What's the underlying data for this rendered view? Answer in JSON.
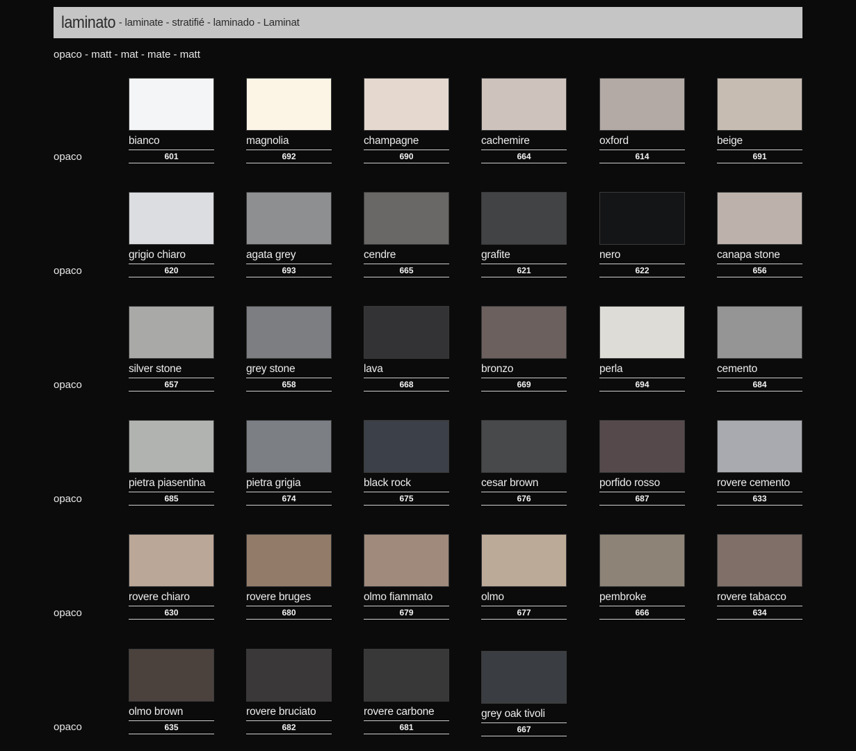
{
  "header": {
    "title": "laminato",
    "subtitle": "- laminate - stratifié - laminado - Laminat"
  },
  "finish_line": "opaco - matt - mat - mate - matt",
  "rows": [
    {
      "label": "opaco",
      "swatches": [
        {
          "name": "bianco",
          "code": "601",
          "color": "#f4f5f7"
        },
        {
          "name": "magnolia",
          "code": "692",
          "color": "#fcf5e6"
        },
        {
          "name": "champagne",
          "code": "690",
          "color": "#e4d8cf"
        },
        {
          "name": "cachemire",
          "code": "664",
          "color": "#cdc3bc"
        },
        {
          "name": "oxford",
          "code": "614",
          "color": "#b3aaa5"
        },
        {
          "name": "beige",
          "code": "691",
          "color": "#c6bcb2"
        }
      ]
    },
    {
      "label": "opaco",
      "swatches": [
        {
          "name": "grigio chiaro",
          "code": "620",
          "color": "#dcdde0"
        },
        {
          "name": "agata grey",
          "code": "693",
          "color": "#8e8f91"
        },
        {
          "name": "cendre",
          "code": "665",
          "color": "#6a6866"
        },
        {
          "name": "grafite",
          "code": "621",
          "color": "#424345"
        },
        {
          "name": "nero",
          "code": "622",
          "color": "#141516"
        },
        {
          "name": "canapa stone",
          "code": "656",
          "color": "#bcb1ab"
        }
      ]
    },
    {
      "label": "opaco",
      "swatches": [
        {
          "name": "silver stone",
          "code": "657",
          "color": "#a9aaa8"
        },
        {
          "name": "grey stone",
          "code": "658",
          "color": "#7c7e82"
        },
        {
          "name": "lava",
          "code": "668",
          "color": "#333234"
        },
        {
          "name": "bronzo",
          "code": "669",
          "color": "#6b605d"
        },
        {
          "name": "perla",
          "code": "694",
          "color": "#dddcd7"
        },
        {
          "name": "cemento",
          "code": "684",
          "color": "#959595"
        }
      ]
    },
    {
      "label": "opaco",
      "swatches": [
        {
          "name": "pietra piasentina",
          "code": "685",
          "color": "#b1b3b1"
        },
        {
          "name": "pietra grigia",
          "code": "674",
          "color": "#7c7f84"
        },
        {
          "name": "black rock",
          "code": "675",
          "color": "#3c4048"
        },
        {
          "name": "cesar brown",
          "code": "676",
          "color": "#47494a"
        },
        {
          "name": "porfido rosso",
          "code": "687",
          "color": "#56494c"
        },
        {
          "name": "rovere cemento",
          "code": "633",
          "color": "#a8aaaf"
        }
      ]
    },
    {
      "label": "opaco",
      "swatches": [
        {
          "name": "rovere chiaro",
          "code": "630",
          "color": "#bba797"
        },
        {
          "name": "rovere bruges",
          "code": "680",
          "color": "#927c69"
        },
        {
          "name": "olmo fiammato",
          "code": "679",
          "color": "#a08a7c"
        },
        {
          "name": "olmo",
          "code": "677",
          "color": "#bcaa98"
        },
        {
          "name": "pembroke",
          "code": "666",
          "color": "#8d8477"
        },
        {
          "name": "rovere tabacco",
          "code": "634",
          "color": "#7f6f68"
        }
      ]
    },
    {
      "label": "opaco",
      "swatches": [
        {
          "name": "olmo brown",
          "code": "635",
          "color": "#4b423e"
        },
        {
          "name": "rovere bruciato",
          "code": "682",
          "color": "#3a3838"
        },
        {
          "name": "rovere carbone",
          "code": "681",
          "color": "#393838"
        },
        {
          "name": "grey oak tivoli",
          "code": "667",
          "color": "#3a3e42"
        }
      ]
    }
  ]
}
